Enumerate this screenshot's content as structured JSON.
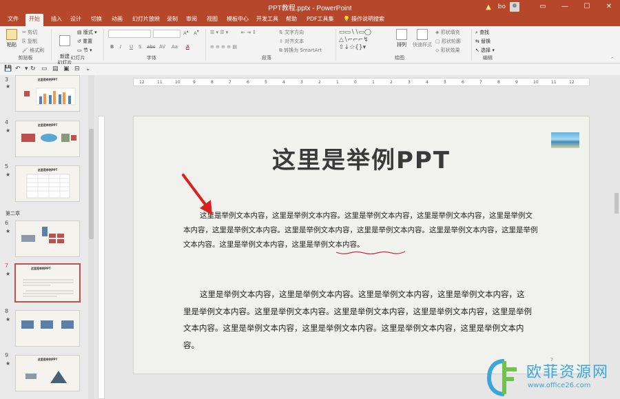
{
  "titlebar": {
    "doc_title": "PPT教程.pptx  -  PowerPoint",
    "warning": "▲",
    "user": "bo",
    "minimize": "—",
    "maximize": "☐",
    "close": "✕",
    "ribbon_toggle": "▭"
  },
  "tabs": [
    "文件",
    "开始",
    "插入",
    "设计",
    "切换",
    "动画",
    "幻灯片放映",
    "录制",
    "审阅",
    "视图",
    "模板中心",
    "开发工具",
    "帮助",
    "PDF工具集",
    "操作说明搜索"
  ],
  "ribbon": {
    "clipboard": {
      "paste": "粘贴",
      "cut": "剪切",
      "copy": "复制",
      "format_painter": "格式刷",
      "label": "剪贴板"
    },
    "slides": {
      "new_slide": "新建\n幻灯片",
      "layout": "版式",
      "reset": "重置",
      "section": "节",
      "label": "幻灯片"
    },
    "font": {
      "label": "字体",
      "bold": "B",
      "italic": "I",
      "underline": "U",
      "strike": "S",
      "abc": "abc",
      "av": "AV",
      "aa": "Aa",
      "a": "A"
    },
    "paragraph": {
      "label": "段落",
      "text_direction": "文字方向",
      "align_text": "对齐文本",
      "smartart": "转换为 SmartArt"
    },
    "drawing": {
      "label": "绘图",
      "arrange": "排列",
      "quick_styles": "快速样式",
      "fill": "形状填充",
      "outline": "形状轮廓",
      "effects": "形状效果"
    },
    "editing": {
      "label": "编辑",
      "find": "查找",
      "replace": "替换",
      "select": "选择"
    }
  },
  "thumbnails": [
    {
      "num": "3",
      "star": "★",
      "title": "这里是举例PPT"
    },
    {
      "num": "4",
      "star": "★",
      "title": "这里是举例PPT"
    },
    {
      "num": "5",
      "star": "★",
      "title": "这里是举例PPT"
    },
    {
      "num": "6",
      "star": "★",
      "title": ""
    },
    {
      "num": "7",
      "star": "★",
      "title": "这里是举例PPT"
    },
    {
      "num": "8",
      "star": "★",
      "title": ""
    },
    {
      "num": "9",
      "star": "★",
      "title": "这里是举例PPT"
    }
  ],
  "section_label": "第二章",
  "ruler_ticks": [
    "12",
    "11",
    "10",
    "9",
    "8",
    "7",
    "6",
    "5",
    "4",
    "3",
    "2",
    "1",
    "0",
    "1",
    "2",
    "3",
    "4",
    "5",
    "6",
    "7",
    "8",
    "9",
    "10",
    "11",
    "12"
  ],
  "slide": {
    "title": "这里是举例PPT",
    "para1_a": "这里是举例文本内容，这里是举例文本内容。这里是举例文本内容，这里是举例文本内容，这里是举例文本内容，这里是举例文本内容。这里是举例文本内容，这里是举例文本内容。这里是举例文本内容，这里是举例文本内容。这里是举例文本内容，",
    "para1_underlined": "这里是举例文本内容",
    "para1_end": "。",
    "para2": "这里是举例文本内容，这里是举例文本内容。这里是举例文本内容，这里是举例文本内容，这里是举例文本内容。这里是举例文本内容。这里是举例文本内容，这里是举例文本内容，这里是举例文本内容。这里是举例文本内容，这里是举例文本内容。这里是举例文本内容，这里是举例文本内容。",
    "page_number": "7"
  },
  "watermark": {
    "text": "欧菲资源网",
    "url": "www.office26.com"
  }
}
